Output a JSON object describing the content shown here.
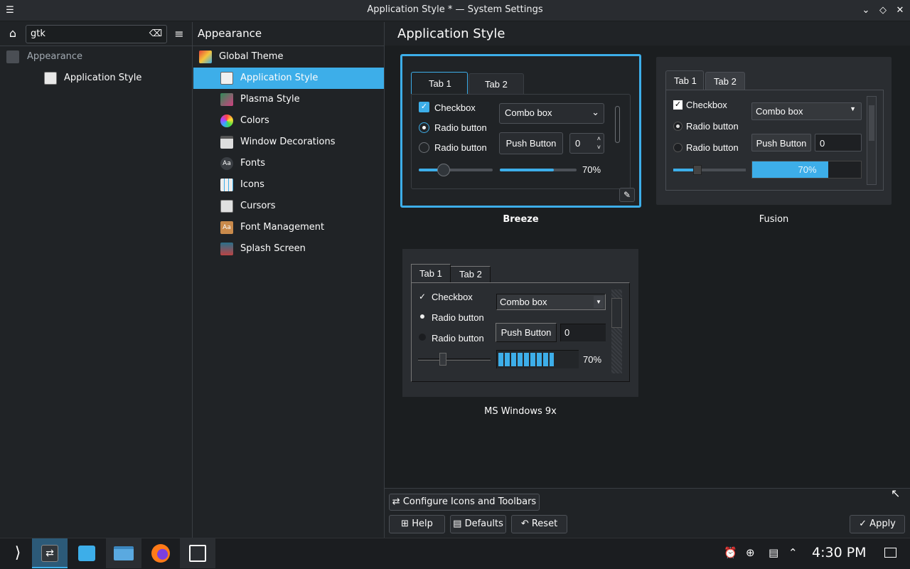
{
  "window": {
    "title": "Application Style * — System Settings"
  },
  "sidebar": {
    "search_value": "gtk",
    "header": "Appearance",
    "items": [
      {
        "label": "Appearance"
      },
      {
        "label": "Application Style"
      }
    ]
  },
  "categories": [
    {
      "label": "Global Theme"
    },
    {
      "label": "Application Style"
    },
    {
      "label": "Plasma Style"
    },
    {
      "label": "Colors"
    },
    {
      "label": "Window Decorations"
    },
    {
      "label": "Fonts"
    },
    {
      "label": "Icons"
    },
    {
      "label": "Cursors"
    },
    {
      "label": "Font Management"
    },
    {
      "label": "Splash Screen"
    }
  ],
  "page": {
    "title": "Application Style"
  },
  "styles": [
    {
      "name": "Breeze",
      "tab1": "Tab 1",
      "tab2": "Tab 2",
      "checkbox": "Checkbox",
      "radio1": "Radio button",
      "radio2": "Radio button",
      "combo": "Combo box",
      "push": "Push Button",
      "spin": "0",
      "progress": "70%"
    },
    {
      "name": "Fusion",
      "tab1": "Tab 1",
      "tab2": "Tab 2",
      "checkbox": "Checkbox",
      "radio1": "Radio button",
      "radio2": "Radio button",
      "combo": "Combo box",
      "push": "Push Button",
      "spin": "0",
      "progress": "70%"
    },
    {
      "name": "MS Windows 9x",
      "tab1": "Tab 1",
      "tab2": "Tab 2",
      "checkbox": "Checkbox",
      "radio1": "Radio button",
      "radio2": "Radio button",
      "combo": "Combo box",
      "push": "Push Button",
      "spin": "0",
      "progress": "70%"
    }
  ],
  "progress_fraction": 0.7,
  "buttons": {
    "configure": "Configure Icons and Toolbars",
    "help": "Help",
    "defaults": "Defaults",
    "reset": "Reset",
    "apply": "Apply"
  },
  "taskbar": {
    "clock": "4:30 PM"
  },
  "colors": {
    "accent": "#3daee9",
    "bg": "#202326",
    "panel": "#292c30"
  }
}
